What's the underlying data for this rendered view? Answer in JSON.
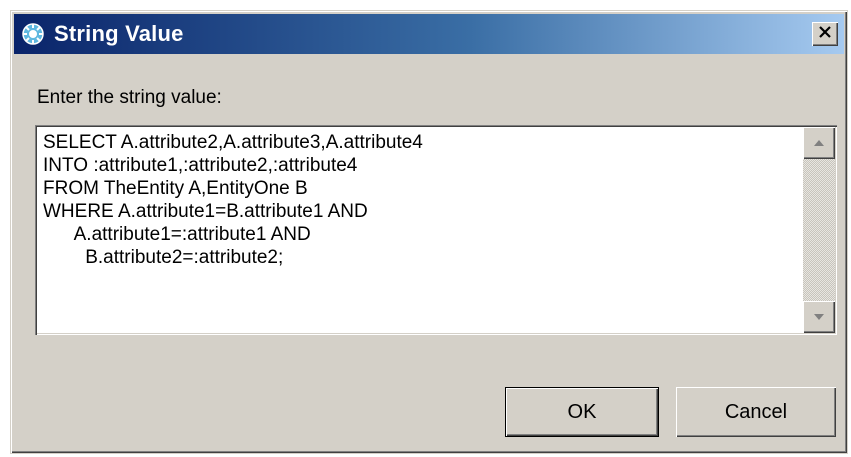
{
  "window": {
    "title": "String Value",
    "icons": {
      "app": "gear-globe-icon",
      "close": "close-icon",
      "scroll_up": "arrow-up-icon",
      "scroll_down": "arrow-down-icon"
    },
    "colors": {
      "titlebar_start": "#0a246a",
      "titlebar_end": "#a6caf0",
      "face": "#d4d0c8"
    }
  },
  "prompt": {
    "label": "Enter the string value:"
  },
  "editor": {
    "value": "SELECT A.attribute2,A.attribute3,A.attribute4\nINTO :attribute1,:attribute2,:attribute4\nFROM TheEntity A,EntityOne B\nWHERE A.attribute1=B.attribute1 AND\n      A.attribute1=:attribute1 AND\n        B.attribute2=:attribute2;"
  },
  "buttons": {
    "ok_label": "OK",
    "cancel_label": "Cancel"
  }
}
